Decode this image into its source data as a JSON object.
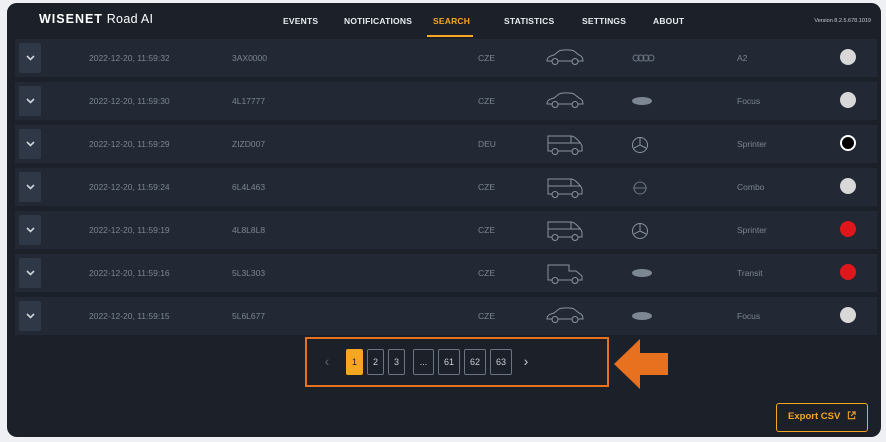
{
  "brand": {
    "logo_bold": "WISENET",
    "logo_rest": "Road AI",
    "version": "Version 8.2.5.678.1019"
  },
  "nav": [
    "EVENTS",
    "NOTIFICATIONS",
    "SEARCH",
    "STATISTICS",
    "SETTINGS",
    "ABOUT"
  ],
  "active_nav": "SEARCH",
  "accent_color": "#f5a623",
  "rows": [
    {
      "datetime": "2022-12-20, 11:59:32",
      "plate": "3AX0000",
      "country": "CZE",
      "vehicle_icon": "car-icon",
      "brand_icon": "audi-logo-icon",
      "model": "A2",
      "color": "#d8d8d8"
    },
    {
      "datetime": "2022-12-20, 11:59:30",
      "plate": "4L17777",
      "country": "CZE",
      "vehicle_icon": "car-icon",
      "brand_icon": "ford-logo-icon",
      "model": "Focus",
      "color": "#d8d8d8"
    },
    {
      "datetime": "2022-12-20, 11:59:29",
      "plate": "ZIZD007",
      "country": "DEU",
      "vehicle_icon": "van-icon",
      "brand_icon": "mercedes-logo-icon",
      "model": "Sprinter",
      "color": "#000000"
    },
    {
      "datetime": "2022-12-20, 11:59:24",
      "plate": "6L4L463",
      "country": "CZE",
      "vehicle_icon": "van-icon",
      "brand_icon": "opel-logo-icon",
      "model": "Combo",
      "color": "#d8d8d8"
    },
    {
      "datetime": "2022-12-20, 11:59:19",
      "plate": "4L8L8L8",
      "country": "CZE",
      "vehicle_icon": "van-icon",
      "brand_icon": "mercedes-logo-icon",
      "model": "Sprinter",
      "color": "#e0161d"
    },
    {
      "datetime": "2022-12-20, 11:59:16",
      "plate": "5L3L303",
      "country": "CZE",
      "vehicle_icon": "truck-icon",
      "brand_icon": "ford-logo-icon",
      "model": "Transit",
      "color": "#e0161d"
    },
    {
      "datetime": "2022-12-20, 11:59:15",
      "plate": "5L6L677",
      "country": "CZE",
      "vehicle_icon": "car-icon",
      "brand_icon": "ford-logo-icon",
      "model": "Focus",
      "color": "#d8d8d8"
    }
  ],
  "pagination": {
    "prev": "‹",
    "pages": [
      "1",
      "2",
      "3",
      "...",
      "61",
      "62",
      "63"
    ],
    "active": "1",
    "next": "›"
  },
  "export_label": "Export CSV"
}
